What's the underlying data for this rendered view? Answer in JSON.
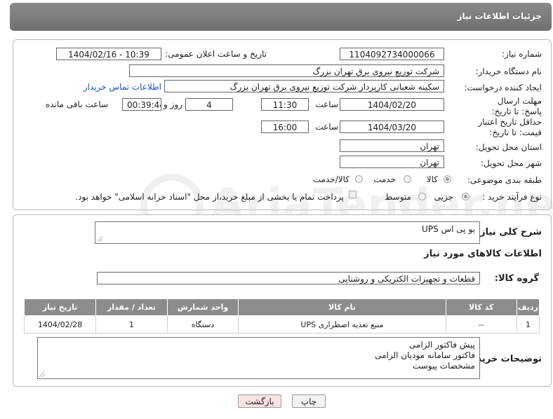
{
  "header": {
    "title": "جزئیات اطلاعات نیاز"
  },
  "watermark": "AriaTender.neT",
  "fields": {
    "need_number_label": "شماره نیاز:",
    "need_number": "1104092734000066",
    "announce_label": "تاریخ و ساعت اعلان عمومی:",
    "announce_value": "1404/02/16 - 10:39",
    "buyer_org_label": "نام دستگاه خریدار:",
    "buyer_org": "شرکت توزیع نیروی برق تهران بزرگ",
    "creator_label": "ایجاد کننده درخواست:",
    "creator": "سکینه شعبانی کارپرداز شرکت توزیع نیروی برق تهران بزرگ",
    "contact_link": "اطلاعات تماس خریدار",
    "deadline_label": "مهلت ارسال پاسخ: تا تاریخ:",
    "deadline_date": "1404/02/20",
    "time_label": "ساعت",
    "deadline_time": "11:30",
    "days": "4",
    "days_label": "روز و",
    "remaining": "00:39:44",
    "remaining_label": "ساعت باقی مانده",
    "validity_label": "حداقل تاریخ اعتبار قیمت: تا تاریخ:",
    "validity_date": "1404/03/20",
    "validity_time": "16:00",
    "province_label": "استان محل تحویل:",
    "province": "تهران",
    "city_label": "شهر محل تحویل:",
    "city": "تهران",
    "category_label": "طبقه بندی موضوعی:",
    "category_options": [
      "کالا",
      "خدمت",
      "کالا/خدمت"
    ],
    "process_label": "نوع فرآیند خرید :",
    "process_options": [
      "جزیی",
      "متوسط"
    ],
    "payment_note": "پرداخت تمام یا بخشی از مبلغ خرید،از محل \"اسناد خزانه اسلامی\" خواهد بود."
  },
  "summary": {
    "desc_label": "شرح کلی نیاز:",
    "desc_value": "یو پی اس UPS",
    "goods_info_title": "اطلاعات کالاهای مورد نیاز",
    "group_label": "گروه کالا:",
    "group_value": "قطعات و تجهیزات الکتریکی و روشنایی"
  },
  "table": {
    "headers": [
      "ردیف",
      "کد کالا",
      "نام کالا",
      "واحد شمارش",
      "تعداد / مقدار",
      "تاریخ نیاز"
    ],
    "rows": [
      [
        "1",
        "--",
        "منبع تغذیه اضطراری UPS",
        "دستگاه",
        "1",
        "1404/02/28"
      ]
    ]
  },
  "buyer_notes": {
    "label": "توضیحات خریدار:",
    "lines": [
      "پیش فاکتور الزامی",
      "فاکتور سامانه مودیان الزامی",
      "مشخصات پیوست"
    ]
  },
  "buttons": {
    "print": "چاپ",
    "back": "بازگشت"
  }
}
